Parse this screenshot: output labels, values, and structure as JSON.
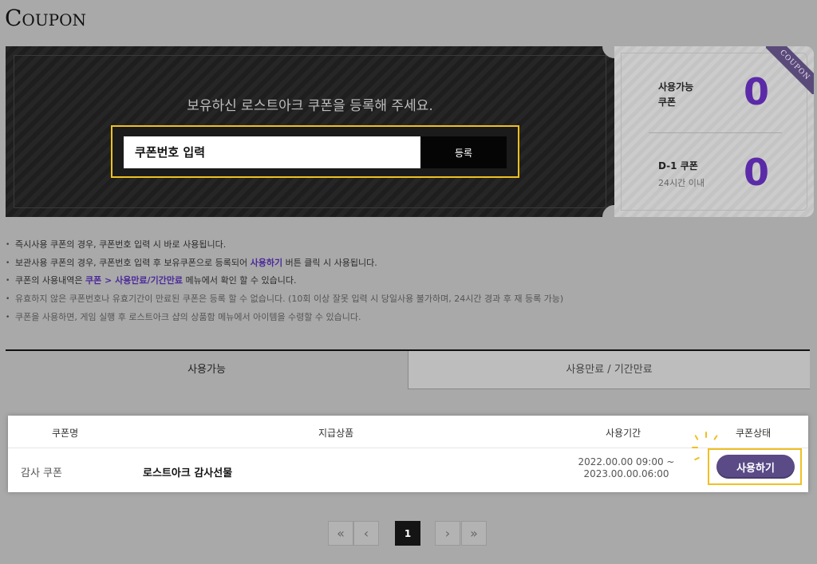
{
  "page": {
    "title": "Coupon"
  },
  "ticket": {
    "headline": "보유하신 로스트아크 쿠폰을 등록해 주세요.",
    "input_placeholder": "쿠폰번호 입력",
    "register_label": "등록",
    "ribbon": "COUPON",
    "available_label_line1": "사용가능",
    "available_label_line2": "쿠폰",
    "available_count": "0",
    "d1_label": "D-1 쿠폰",
    "d1_sub": "24시간 이내",
    "d1_count": "0"
  },
  "notices": {
    "n1": "즉시사용 쿠폰의 경우, 쿠폰번호 입력 시 바로 사용됩니다.",
    "n2_a": "보관사용 쿠폰의 경우, 쿠폰번호 입력 후 보유쿠폰으로 등록되어 ",
    "n2_hl": "사용하기",
    "n2_b": " 버튼 클릭 시 사용됩니다.",
    "n3_a": "쿠폰의 사용내역은 ",
    "n3_hl": "쿠폰 > 사용만료/기간만료",
    "n3_b": " 메뉴에서 확인 할 수 있습니다.",
    "n4": "유효하지 않은 쿠폰번호나 유효기간이 만료된 쿠폰은 등록 할 수 없습니다. (10회 이상 잘못 입력 시 당일사용 불가하며, 24시간 경과 후 재 등록 가능)",
    "n5": "쿠폰을 사용하면, 게임 실행 후 로스트아크 샵의 상품함 메뉴에서 아이템을 수령할 수 있습니다."
  },
  "tabs": {
    "available": "사용가능",
    "expired": "사용만료 / 기간만료"
  },
  "table": {
    "headers": {
      "name": "쿠폰명",
      "product": "지급상품",
      "period": "사용기간",
      "status": "쿠폰상태"
    },
    "row": {
      "name": "감사 쿠폰",
      "product": "로스트아크 감사선물",
      "period_start": "2022.00.00 09:00 ~",
      "period_end": "2023.00.00.06:00",
      "action": "사용하기"
    }
  },
  "pagination": {
    "first": "«",
    "prev": "‹",
    "current": "1",
    "next": "›",
    "last": "»"
  }
}
